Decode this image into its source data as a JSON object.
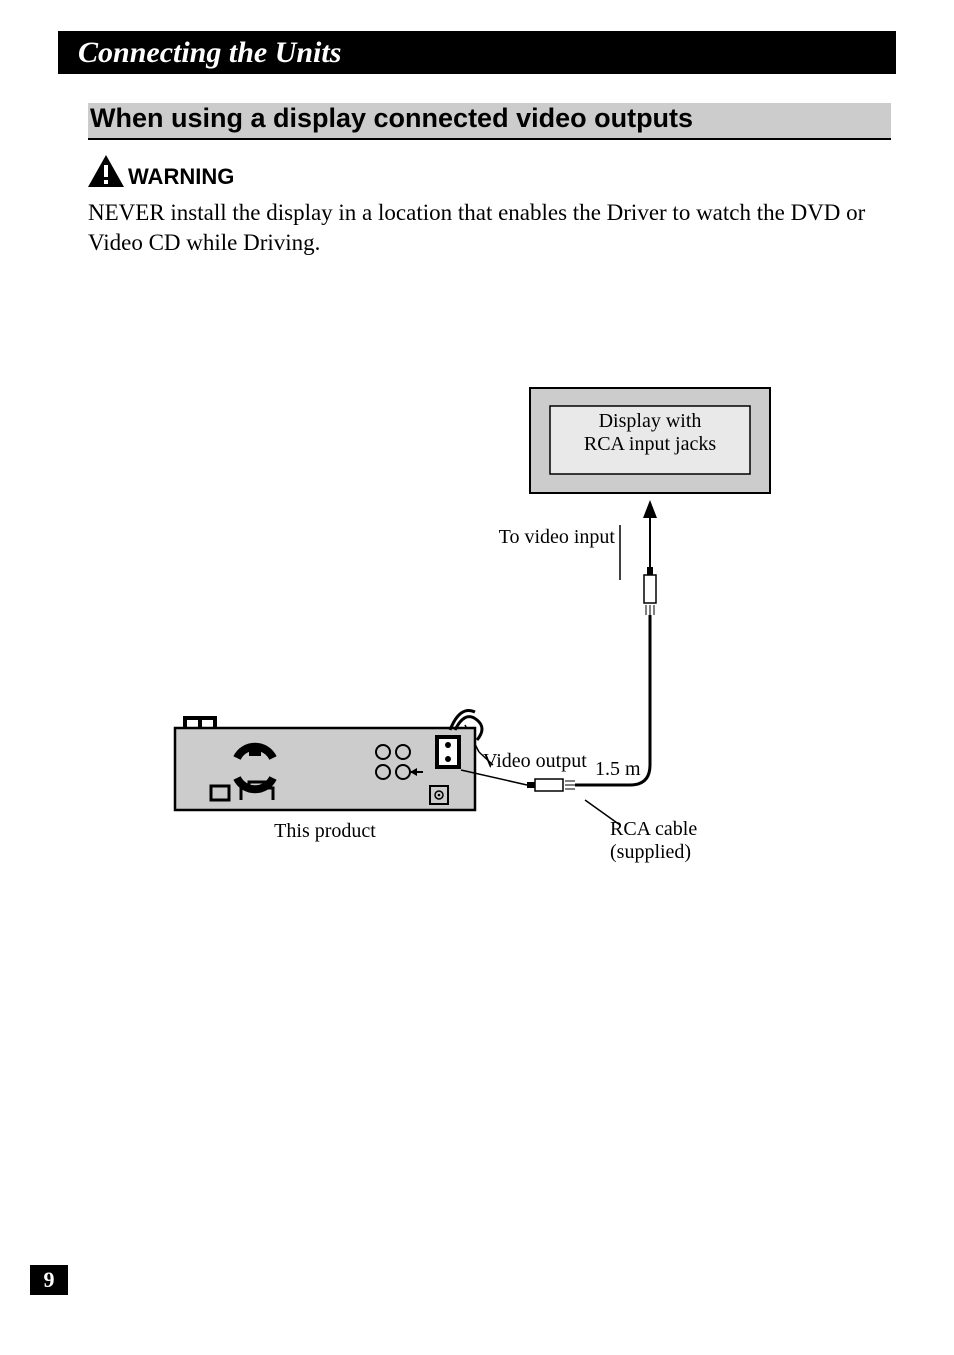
{
  "titleBar": "Connecting the Units",
  "sectionHeading": "When using a display connected video outputs",
  "warningLabel": "WARNING",
  "warningBody": "NEVER install the display in a location that enables the Driver to watch the DVD or Video CD while Driving.",
  "diagram": {
    "displayBox": {
      "line1": "Display with",
      "line2": "RCA input jacks"
    },
    "toVideoInput": "To video input",
    "videoOutput": "Video output",
    "cableLength": "1.5 m",
    "rcaCable": {
      "line1": "RCA cable",
      "line2": "(supplied)"
    },
    "thisProduct": "This product"
  },
  "pageNumber": "9"
}
